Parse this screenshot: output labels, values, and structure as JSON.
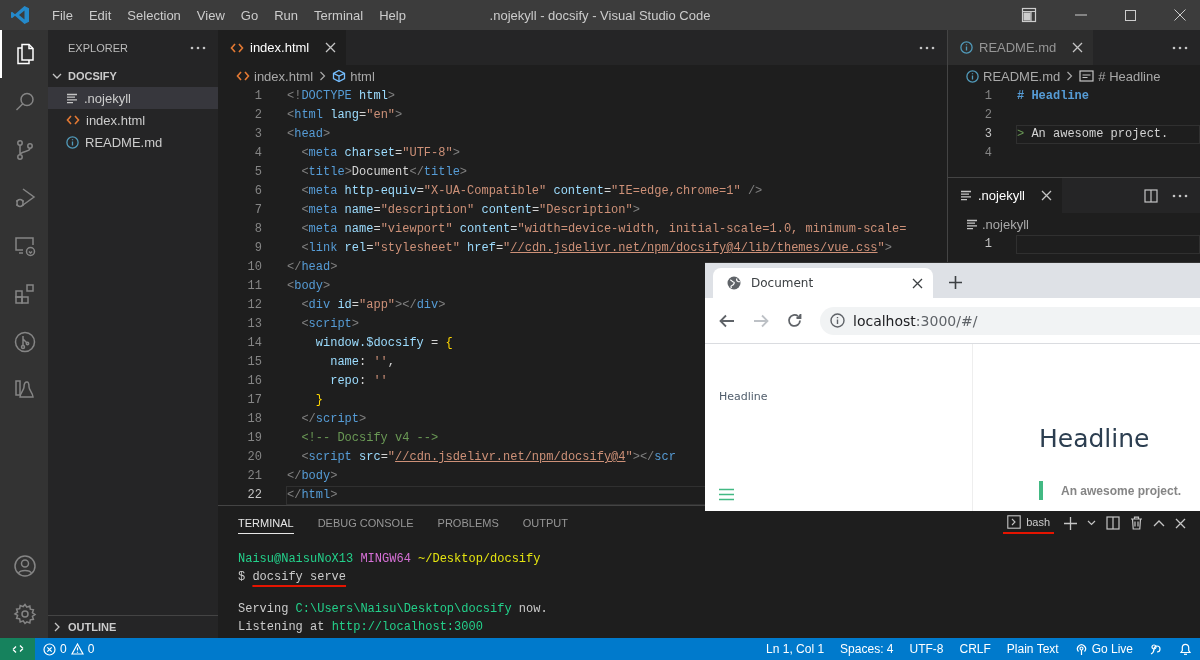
{
  "title_bar": {
    "menu": [
      "File",
      "Edit",
      "Selection",
      "View",
      "Go",
      "Run",
      "Terminal",
      "Help"
    ],
    "title": ".nojekyll - docsify - Visual Studio Code"
  },
  "activity_bar": {
    "items": [
      {
        "kind": "explorer",
        "selected": true
      },
      {
        "kind": "search",
        "selected": false
      },
      {
        "kind": "source_control",
        "selected": false
      },
      {
        "kind": "run_debug",
        "selected": false
      },
      {
        "kind": "remote",
        "selected": false
      },
      {
        "kind": "extensions",
        "selected": false
      },
      {
        "kind": "git_graph",
        "selected": false
      },
      {
        "kind": "wsl",
        "selected": false
      }
    ],
    "bottom_items": [
      {
        "kind": "account",
        "selected": false
      },
      {
        "kind": "settings",
        "selected": false
      }
    ]
  },
  "sidebar": {
    "title": "EXPLORER",
    "folder": {
      "name": "DOCSIFY",
      "expanded": true
    },
    "files": [
      {
        "name": ".nojekyll",
        "kind": "text",
        "selected": true
      },
      {
        "name": "index.html",
        "kind": "html",
        "selected": false
      },
      {
        "name": "README.md",
        "kind": "info",
        "selected": false
      }
    ],
    "outline": {
      "label": "OUTLINE",
      "expanded": false
    }
  },
  "editor": {
    "tabs": [
      {
        "label": "index.html",
        "kind": "html",
        "selected": true
      }
    ],
    "breadcrumb": [
      {
        "text": "index.html",
        "kind": "html"
      },
      {
        "text": "html",
        "kind": "element"
      }
    ],
    "lines": [
      {
        "number": "1",
        "current": false,
        "tokens": [
          {
            "text": "<!",
            "kind": "punct"
          },
          {
            "text": "DOCTYPE",
            "kind": "tag"
          },
          {
            "text": " html",
            "kind": "attr"
          },
          {
            "text": ">",
            "kind": "punct"
          }
        ]
      },
      {
        "number": "2",
        "current": false,
        "tokens": [
          {
            "text": "<",
            "kind": "punct"
          },
          {
            "text": "html",
            "kind": "tag"
          },
          {
            "text": " lang",
            "kind": "attr"
          },
          {
            "text": "=",
            "kind": "text"
          },
          {
            "text": "\"en\"",
            "kind": "string"
          },
          {
            "text": ">",
            "kind": "punct"
          }
        ]
      },
      {
        "number": "3",
        "current": false,
        "tokens": [
          {
            "text": "<",
            "kind": "punct"
          },
          {
            "text": "head",
            "kind": "tag"
          },
          {
            "text": ">",
            "kind": "punct"
          }
        ]
      },
      {
        "number": "4",
        "current": false,
        "tokens": [
          {
            "text": "  <",
            "kind": "punct"
          },
          {
            "text": "meta",
            "kind": "tag"
          },
          {
            "text": " charset",
            "kind": "attr"
          },
          {
            "text": "=",
            "kind": "text"
          },
          {
            "text": "\"UTF-8\"",
            "kind": "string"
          },
          {
            "text": ">",
            "kind": "punct"
          }
        ]
      },
      {
        "number": "5",
        "current": false,
        "tokens": [
          {
            "text": "  <",
            "kind": "punct"
          },
          {
            "text": "title",
            "kind": "tag"
          },
          {
            "text": ">",
            "kind": "punct"
          },
          {
            "text": "Document",
            "kind": "text"
          },
          {
            "text": "</",
            "kind": "punct"
          },
          {
            "text": "title",
            "kind": "tag"
          },
          {
            "text": ">",
            "kind": "punct"
          }
        ]
      },
      {
        "number": "6",
        "current": false,
        "tokens": [
          {
            "text": "  <",
            "kind": "punct"
          },
          {
            "text": "meta",
            "kind": "tag"
          },
          {
            "text": " http-equiv",
            "kind": "attr"
          },
          {
            "text": "=",
            "kind": "text"
          },
          {
            "text": "\"X-UA-Compatible\"",
            "kind": "string"
          },
          {
            "text": " content",
            "kind": "attr"
          },
          {
            "text": "=",
            "kind": "text"
          },
          {
            "text": "\"IE=edge,chrome=1\"",
            "kind": "string"
          },
          {
            "text": " />",
            "kind": "punct"
          }
        ]
      },
      {
        "number": "7",
        "current": false,
        "tokens": [
          {
            "text": "  <",
            "kind": "punct"
          },
          {
            "text": "meta",
            "kind": "tag"
          },
          {
            "text": " name",
            "kind": "attr"
          },
          {
            "text": "=",
            "kind": "text"
          },
          {
            "text": "\"description\"",
            "kind": "string"
          },
          {
            "text": " content",
            "kind": "attr"
          },
          {
            "text": "=",
            "kind": "text"
          },
          {
            "text": "\"Description\"",
            "kind": "string"
          },
          {
            "text": ">",
            "kind": "punct"
          }
        ]
      },
      {
        "number": "8",
        "current": false,
        "tokens": [
          {
            "text": "  <",
            "kind": "punct"
          },
          {
            "text": "meta",
            "kind": "tag"
          },
          {
            "text": " name",
            "kind": "attr"
          },
          {
            "text": "=",
            "kind": "text"
          },
          {
            "text": "\"viewport\"",
            "kind": "string"
          },
          {
            "text": " content",
            "kind": "attr"
          },
          {
            "text": "=",
            "kind": "text"
          },
          {
            "text": "\"width=device-width, initial-scale=1.0, minimum-scale=",
            "kind": "string"
          }
        ]
      },
      {
        "number": "9",
        "current": false,
        "tokens": [
          {
            "text": "  <",
            "kind": "punct"
          },
          {
            "text": "link",
            "kind": "tag"
          },
          {
            "text": " rel",
            "kind": "attr"
          },
          {
            "text": "=",
            "kind": "text"
          },
          {
            "text": "\"stylesheet\"",
            "kind": "string"
          },
          {
            "text": " href",
            "kind": "attr"
          },
          {
            "text": "=",
            "kind": "text"
          },
          {
            "text": "\"",
            "kind": "string"
          },
          {
            "text": "//cdn.jsdelivr.net/npm/docsify@4/lib/themes/vue.css",
            "kind": "link"
          },
          {
            "text": "\"",
            "kind": "string"
          },
          {
            "text": ">",
            "kind": "punct"
          }
        ]
      },
      {
        "number": "10",
        "current": false,
        "tokens": [
          {
            "text": "</",
            "kind": "punct"
          },
          {
            "text": "head",
            "kind": "tag"
          },
          {
            "text": ">",
            "kind": "punct"
          }
        ]
      },
      {
        "number": "11",
        "current": false,
        "tokens": [
          {
            "text": "<",
            "kind": "punct"
          },
          {
            "text": "body",
            "kind": "tag"
          },
          {
            "text": ">",
            "kind": "punct"
          }
        ]
      },
      {
        "number": "12",
        "current": false,
        "tokens": [
          {
            "text": "  <",
            "kind": "punct"
          },
          {
            "text": "div",
            "kind": "tag"
          },
          {
            "text": " id",
            "kind": "attr"
          },
          {
            "text": "=",
            "kind": "text"
          },
          {
            "text": "\"app\"",
            "kind": "string"
          },
          {
            "text": "></",
            "kind": "punct"
          },
          {
            "text": "div",
            "kind": "tag"
          },
          {
            "text": ">",
            "kind": "punct"
          }
        ]
      },
      {
        "number": "13",
        "current": false,
        "tokens": [
          {
            "text": "  <",
            "kind": "punct"
          },
          {
            "text": "script",
            "kind": "tag"
          },
          {
            "text": ">",
            "kind": "punct"
          }
        ]
      },
      {
        "number": "14",
        "current": false,
        "tokens": [
          {
            "text": "    window.$docsify",
            "kind": "attr"
          },
          {
            "text": " = ",
            "kind": "text"
          },
          {
            "text": "{",
            "kind": "brace"
          }
        ]
      },
      {
        "number": "15",
        "current": false,
        "tokens": [
          {
            "text": "      name",
            "kind": "attr"
          },
          {
            "text": ": ",
            "kind": "text"
          },
          {
            "text": "''",
            "kind": "string"
          },
          {
            "text": ",",
            "kind": "text"
          }
        ]
      },
      {
        "number": "16",
        "current": false,
        "tokens": [
          {
            "text": "      repo",
            "kind": "attr"
          },
          {
            "text": ": ",
            "kind": "text"
          },
          {
            "text": "''",
            "kind": "string"
          }
        ]
      },
      {
        "number": "17",
        "current": false,
        "tokens": [
          {
            "text": "    }",
            "kind": "brace"
          }
        ]
      },
      {
        "number": "18",
        "current": false,
        "tokens": [
          {
            "text": "  </",
            "kind": "punct"
          },
          {
            "text": "script",
            "kind": "tag"
          },
          {
            "text": ">",
            "kind": "punct"
          }
        ]
      },
      {
        "number": "19",
        "current": false,
        "tokens": [
          {
            "text": "  <!-- Docsify v4 -->",
            "kind": "comment"
          }
        ]
      },
      {
        "number": "20",
        "current": false,
        "tokens": [
          {
            "text": "  <",
            "kind": "punct"
          },
          {
            "text": "script",
            "kind": "tag"
          },
          {
            "text": " src",
            "kind": "attr"
          },
          {
            "text": "=",
            "kind": "text"
          },
          {
            "text": "\"",
            "kind": "string"
          },
          {
            "text": "//cdn.jsdelivr.net/npm/docsify@4",
            "kind": "link"
          },
          {
            "text": "\"",
            "kind": "string"
          },
          {
            "text": "></",
            "kind": "punct"
          },
          {
            "text": "scr",
            "kind": "tag"
          }
        ]
      },
      {
        "number": "21",
        "current": false,
        "tokens": [
          {
            "text": "</",
            "kind": "punct"
          },
          {
            "text": "body",
            "kind": "tag"
          },
          {
            "text": ">",
            "kind": "punct"
          }
        ]
      },
      {
        "number": "22",
        "current": true,
        "tokens": [
          {
            "text": "</",
            "kind": "punct"
          },
          {
            "text": "html",
            "kind": "tag"
          },
          {
            "text": ">",
            "kind": "punct"
          }
        ]
      }
    ]
  },
  "right_groups": [
    {
      "tabs": [
        {
          "label": "README.md",
          "kind": "info",
          "selected": false
        }
      ],
      "breadcrumb": [
        {
          "text": "README.md",
          "kind": "info"
        },
        {
          "text": "# Headline",
          "kind": "section"
        }
      ],
      "lines": [
        {
          "number": "1",
          "current": false,
          "tokens": [
            {
              "text": "# Headline",
              "kind": "heading"
            }
          ]
        },
        {
          "number": "2",
          "current": false
        },
        {
          "number": "3",
          "current": true,
          "tokens": [
            {
              "text": "> ",
              "kind": "quote"
            },
            {
              "text": "An awesome project.",
              "kind": "text"
            }
          ]
        },
        {
          "number": "4",
          "current": false
        }
      ]
    },
    {
      "tabs": [
        {
          "label": ".nojekyll",
          "kind": "text",
          "selected": true
        }
      ],
      "breadcrumb": [
        {
          "text": ".nojekyll",
          "kind": "text"
        }
      ],
      "lines": [
        {
          "number": "1",
          "current": true
        }
      ]
    }
  ],
  "browser": {
    "tab": {
      "title": "Document"
    },
    "forward_disabled": true,
    "url_host": "localhost",
    "url_rest": ":3000/#/",
    "page": {
      "sidebar_link": "Headline",
      "heading": "Headline",
      "quote": "An awesome project."
    }
  },
  "panel": {
    "tabs": [
      {
        "label": "TERMINAL",
        "selected": true
      },
      {
        "label": "DEBUG CONSOLE",
        "selected": false
      },
      {
        "label": "PROBLEMS",
        "selected": false
      },
      {
        "label": "OUTPUT",
        "selected": false
      }
    ],
    "shell": {
      "label": "bash",
      "marked": true
    },
    "lines": [
      {
        "kind": "line",
        "tokens": [
          {
            "text": "Naisu@NaisuNoX13",
            "kind": "user"
          },
          {
            "text": " MINGW64",
            "kind": "host"
          },
          {
            "text": " ~/Desktop/docsify",
            "kind": "path"
          }
        ]
      },
      {
        "kind": "line",
        "tokens": [
          {
            "text": "$ ",
            "kind": "plain"
          },
          {
            "text": "docsify serve",
            "kind": "marked"
          }
        ]
      },
      {
        "kind": "blank"
      },
      {
        "kind": "line",
        "tokens": [
          {
            "text": "Serving ",
            "kind": "plain"
          },
          {
            "text": "C:\\Users\\Naisu\\Desktop\\docsify",
            "kind": "value"
          },
          {
            "text": " now.",
            "kind": "plain"
          }
        ]
      },
      {
        "kind": "line",
        "tokens": [
          {
            "text": "Listening at ",
            "kind": "plain"
          },
          {
            "text": "http://localhost:3000",
            "kind": "value"
          }
        ]
      }
    ]
  },
  "status_bar": {
    "errors": "0",
    "warnings": "0",
    "right": [
      {
        "text": "Ln 1, Col 1",
        "kind": "plain"
      },
      {
        "text": "Spaces: 4",
        "kind": "plain"
      },
      {
        "text": "UTF-8",
        "kind": "plain"
      },
      {
        "text": "CRLF",
        "kind": "plain"
      },
      {
        "text": "Plain Text",
        "kind": "plain"
      },
      {
        "text": "Go Live",
        "kind": "live"
      }
    ]
  }
}
